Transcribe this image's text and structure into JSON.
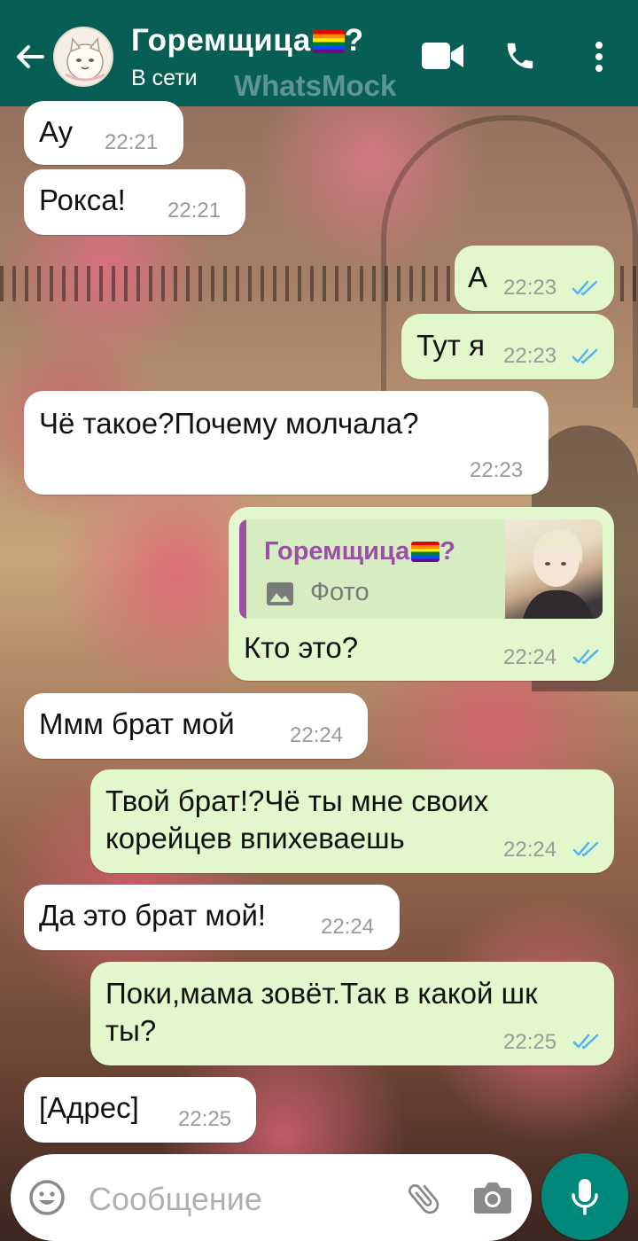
{
  "header": {
    "contact_name": "Горемщица",
    "contact_name_suffix": "?",
    "status": "В сети",
    "watermark": "WhatsMock",
    "icons": [
      "back-arrow-icon",
      "video-call-icon",
      "phone-icon",
      "more-vert-icon"
    ]
  },
  "messages": [
    {
      "direction": "in",
      "text": "Ау",
      "time": "22:21"
    },
    {
      "direction": "in",
      "text": "Рокса!",
      "time": "22:21"
    },
    {
      "direction": "out",
      "text": "А",
      "time": "22:23",
      "status": "read"
    },
    {
      "direction": "out",
      "text": "Тут я",
      "time": "22:23",
      "status": "read"
    },
    {
      "direction": "in",
      "text": "Чё такое?Почему молчала?",
      "time": "22:23"
    },
    {
      "direction": "out",
      "text": "Кто это?",
      "time": "22:24",
      "status": "read",
      "reply": {
        "name": "Горемщица",
        "name_suffix": "?",
        "type": "Фото"
      }
    },
    {
      "direction": "in",
      "text": "Ммм брат мой",
      "time": "22:24"
    },
    {
      "direction": "out",
      "text_line1": "Твой брат!?Чё ты мне своих",
      "text_line2": "корейцев впихеваешь",
      "time": "22:24",
      "status": "read"
    },
    {
      "direction": "in",
      "text": "Да это брат мой!",
      "time": "22:24"
    },
    {
      "direction": "out",
      "text_line1": "Поки,мама зовёт.Так в какой шк",
      "text_line2": "ты?",
      "time": "22:25",
      "status": "read"
    },
    {
      "direction": "in",
      "text": "[Адрес]",
      "time": "22:25"
    }
  ],
  "composer": {
    "placeholder": "Сообщение",
    "icons": [
      "emoji-icon",
      "attach-icon",
      "camera-icon",
      "mic-icon"
    ]
  },
  "colors": {
    "header": "#075e54",
    "outgoing_bubble": "#e2f7cb",
    "incoming_bubble": "#ffffff",
    "read_tick": "#4fb3f6",
    "mic_button": "#00897b",
    "reply_name": "#9b4fa6"
  }
}
